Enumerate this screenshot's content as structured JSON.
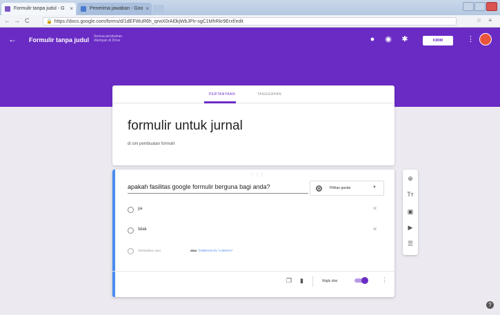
{
  "browser": {
    "tabs": [
      {
        "label": "Formulir tanpa judul - G",
        "close": "×"
      },
      {
        "label": "Penerima jawaban - Goo",
        "close": "×"
      }
    ],
    "nav": {
      "back": "←",
      "forward": "→",
      "reload": "C"
    },
    "url": "https://docs.google.com/forms/d/1dEFWuR6h_qrwX0rAl0kjWbJPIr-sgC1MhRkr9Erxf/edit",
    "lock": "🔒",
    "right_icons": "☆ ≡"
  },
  "header": {
    "back_icon": "arrow-back-icon",
    "title": "Formulir tanpa judul",
    "saved_status": "Semua perubahan disimpan di Drive",
    "send_label": "KIRIM",
    "accent_color": "#6a2bc4"
  },
  "tabs": {
    "questions": "PERTANYAAN",
    "responses": "TANGGAPAN"
  },
  "form": {
    "title": "formulir untuk jurnal",
    "description": "di sini pembuatan formulir"
  },
  "question": {
    "text": "apakah fasilitas google formulir berguna bagi anda?",
    "type_label": "Pilihan ganda",
    "options": [
      {
        "label": "ya"
      },
      {
        "label": "tidak"
      }
    ],
    "add_option": {
      "add_text": "Tambahkan opsi",
      "or_text": "atau",
      "other_text": "TAMBAHKAN \"LAINNYA\""
    },
    "required_label": "Wajib diisi",
    "required_on": true
  },
  "side_toolbar": [
    "add-question-icon",
    "add-title-icon",
    "add-image-icon",
    "add-video-icon",
    "add-section-icon"
  ]
}
